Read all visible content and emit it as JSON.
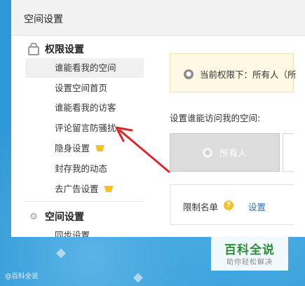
{
  "header": {
    "title": "空间设置"
  },
  "sidebar": {
    "sections": [
      {
        "label": "权限设置",
        "icon": "lock-icon"
      },
      {
        "label": "空间设置",
        "icon": "puzzle-icon"
      }
    ],
    "items": [
      {
        "label": "谁能看我的空间"
      },
      {
        "label": "设置空间首页"
      },
      {
        "label": "谁能看我的访客"
      },
      {
        "label": "评论留言防骚扰"
      },
      {
        "label": "隐身设置"
      },
      {
        "label": "封存我的动态"
      },
      {
        "label": "去广告设置"
      },
      {
        "label": "同步设置"
      }
    ]
  },
  "main": {
    "notice": "当前权限下：所有人（所",
    "access_label": "设置谁能访问我的空间:",
    "everyone_option": "所有人",
    "limit": {
      "label": "限制名单",
      "help": "?",
      "link": "设置"
    }
  },
  "watermark": {
    "title": "百科全说",
    "subtitle": "助你轻松解决"
  },
  "corner_text": "@百科全说",
  "colors": {
    "accent_link": "#2a6fb3",
    "vip_gold": "#f3c12a",
    "arrow_red": "#d42a2a",
    "selected_bg": "#f0f0f0"
  }
}
